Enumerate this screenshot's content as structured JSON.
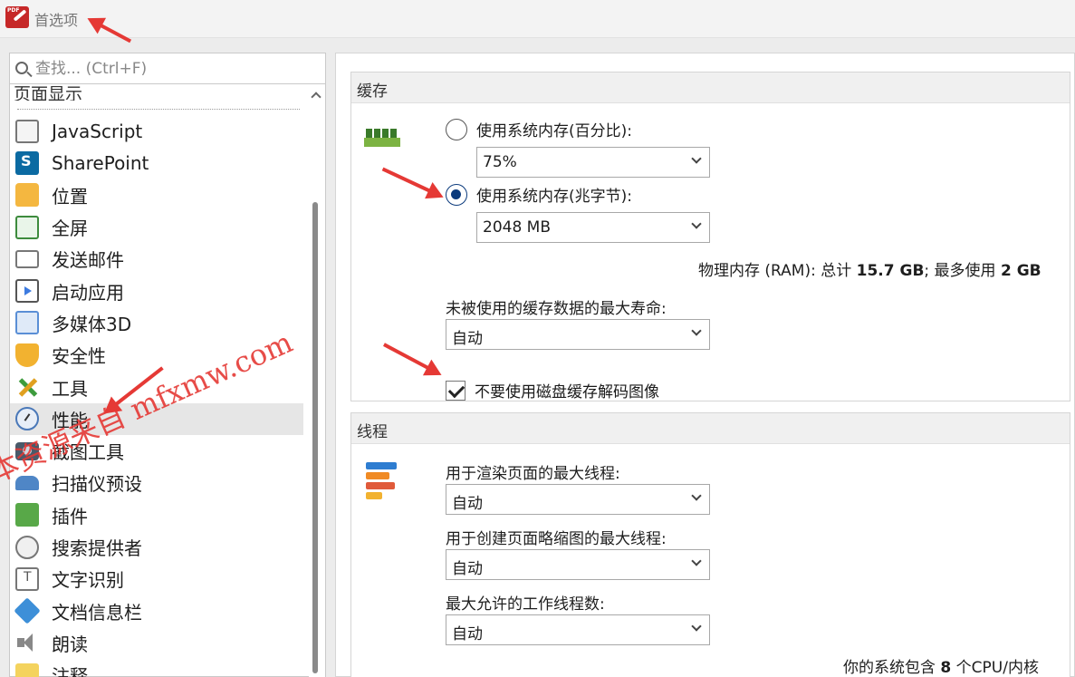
{
  "window": {
    "title": "首选项",
    "app_icon_label": "PDF"
  },
  "search": {
    "placeholder": "查找... (Ctrl+F)"
  },
  "sidebar": {
    "partial_item": "页面显示",
    "items": [
      {
        "label": "JavaScript",
        "icon": "javascript-icon"
      },
      {
        "label": "SharePoint",
        "icon": "sharepoint-icon"
      },
      {
        "label": "位置",
        "icon": "folder-icon"
      },
      {
        "label": "全屏",
        "icon": "fullscreen-icon"
      },
      {
        "label": "发送邮件",
        "icon": "mail-icon"
      },
      {
        "label": "启动应用",
        "icon": "app-launch-icon"
      },
      {
        "label": "多媒体3D",
        "icon": "cube-icon"
      },
      {
        "label": "安全性",
        "icon": "shield-icon"
      },
      {
        "label": "工具",
        "icon": "tools-icon"
      },
      {
        "label": "性能",
        "icon": "gauge-icon",
        "selected": true
      },
      {
        "label": "截图工具",
        "icon": "camera-icon"
      },
      {
        "label": "扫描仪预设",
        "icon": "scanner-icon"
      },
      {
        "label": "插件",
        "icon": "plugin-icon"
      },
      {
        "label": "搜索提供者",
        "icon": "globe-icon"
      },
      {
        "label": "文字识别",
        "icon": "ocr-icon"
      },
      {
        "label": "文档信息栏",
        "icon": "info-icon"
      },
      {
        "label": "朗读",
        "icon": "speaker-icon"
      },
      {
        "label": "注释",
        "icon": "note-icon"
      }
    ]
  },
  "cache": {
    "header": "缓存",
    "radio_percent_label": "使用系统内存(百分比):",
    "percent_value": "75%",
    "radio_mb_label": "使用系统内存(兆字节):",
    "mb_value": "2048 MB",
    "ram_prefix": "物理内存 (RAM): 总计 ",
    "ram_total": "15.7 GB",
    "ram_mid": "; 最多使用 ",
    "ram_max": "2 GB",
    "lifetime_label": "未被使用的缓存数据的最大寿命:",
    "lifetime_value": "自动",
    "checkbox_label": "不要使用磁盘缓存解码图像",
    "checkbox_checked": true
  },
  "threads": {
    "header": "线程",
    "render_label": "用于渲染页面的最大线程:",
    "render_value": "自动",
    "thumb_label": "用于创建页面略缩图的最大线程:",
    "thumb_value": "自动",
    "work_label": "最大允许的工作线程数:",
    "work_value": "自动",
    "cpu_prefix": "你的系统包含 ",
    "cpu_count": "8",
    "cpu_suffix": " 个CPU/内核"
  },
  "watermark": "本资源来自 mfxmw.com",
  "colors": {
    "accent": "#0b3a7c",
    "arrow": "#e53935",
    "selected_bg": "#e6e6e6"
  }
}
